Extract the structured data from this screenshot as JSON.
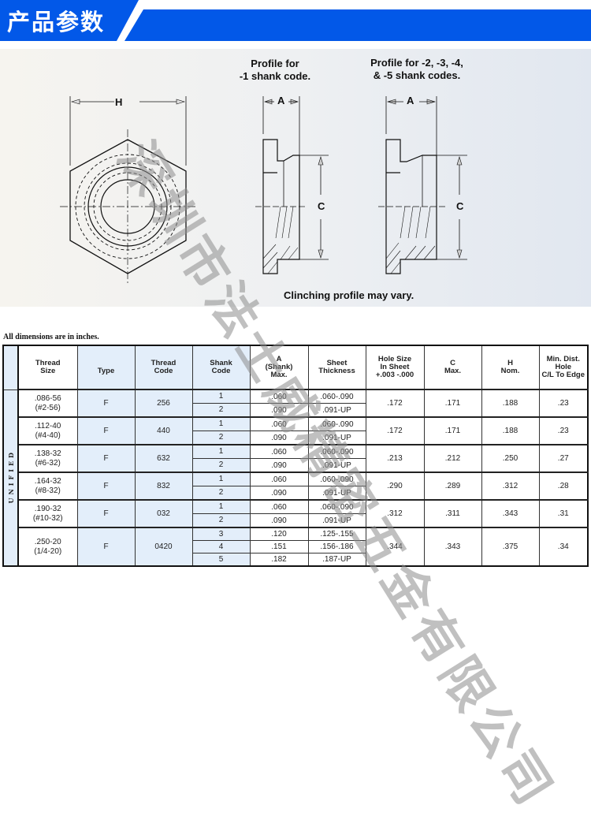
{
  "banner": {
    "title": "产品参数",
    "color": "#0258e8"
  },
  "drawing": {
    "hex_dimension_label": "H",
    "profile1_caption_line1": "Profile for",
    "profile1_caption_line2": "-1 shank code.",
    "profile2_caption_line1": "Profile for -2, -3, -4,",
    "profile2_caption_line2": "& -5 shank codes.",
    "dimension_a": "A",
    "dimension_c": "C",
    "footnote": "Clinching profile may vary."
  },
  "note": "All dimensions are in inches.",
  "table": {
    "side_label": "UNIFIED",
    "headers": {
      "thread_size": "Thread\nSize",
      "type": "Type",
      "thread_code": "Thread\nCode",
      "shank_code": "Shank\nCode",
      "a_shank_max": "A\n(Shank)\nMax.",
      "sheet_thickness": "Sheet\nThickness",
      "hole_size": "Hole Size\nIn Sheet\n+.003 -.000",
      "c_max": "C\nMax.",
      "h_nom": "H\nNom.",
      "min_dist": "Min. Dist. Hole\nC/L To Edge"
    },
    "rows": [
      {
        "thread_size": ".086-56",
        "thread_size_alt": "(#2-56)",
        "type": "F",
        "thread_code": "256",
        "shanks": [
          {
            "code": "1",
            "a": ".060",
            "sheet": ".060-.090"
          },
          {
            "code": "2",
            "a": ".090",
            "sheet": ".091-UP"
          }
        ],
        "hole": ".172",
        "c": ".171",
        "h": ".188",
        "min_dist": ".23"
      },
      {
        "thread_size": ".112-40",
        "thread_size_alt": "(#4-40)",
        "type": "F",
        "thread_code": "440",
        "shanks": [
          {
            "code": "1",
            "a": ".060",
            "sheet": ".060-.090"
          },
          {
            "code": "2",
            "a": ".090",
            "sheet": ".091-UP"
          }
        ],
        "hole": ".172",
        "c": ".171",
        "h": ".188",
        "min_dist": ".23"
      },
      {
        "thread_size": ".138-32",
        "thread_size_alt": "(#6-32)",
        "type": "F",
        "thread_code": "632",
        "shanks": [
          {
            "code": "1",
            "a": ".060",
            "sheet": ".060-.090"
          },
          {
            "code": "2",
            "a": ".090",
            "sheet": ".091-UP"
          }
        ],
        "hole": ".213",
        "c": ".212",
        "h": ".250",
        "min_dist": ".27"
      },
      {
        "thread_size": ".164-32",
        "thread_size_alt": "(#8-32)",
        "type": "F",
        "thread_code": "832",
        "shanks": [
          {
            "code": "1",
            "a": ".060",
            "sheet": ".060-.090"
          },
          {
            "code": "2",
            "a": ".090",
            "sheet": ".091-UP"
          }
        ],
        "hole": ".290",
        "c": ".289",
        "h": ".312",
        "min_dist": ".28"
      },
      {
        "thread_size": ".190-32",
        "thread_size_alt": "(#10-32)",
        "type": "F",
        "thread_code": "032",
        "shanks": [
          {
            "code": "1",
            "a": ".060",
            "sheet": ".060-.090"
          },
          {
            "code": "2",
            "a": ".090",
            "sheet": ".091-UP"
          }
        ],
        "hole": ".312",
        "c": ".311",
        "h": ".343",
        "min_dist": ".31"
      },
      {
        "thread_size": ".250-20",
        "thread_size_alt": "(1/4-20)",
        "type": "F",
        "thread_code": "0420",
        "shanks": [
          {
            "code": "3",
            "a": ".120",
            "sheet": ".125-.155"
          },
          {
            "code": "4",
            "a": ".151",
            "sheet": ".156-.186"
          },
          {
            "code": "5",
            "a": ".182",
            "sheet": ".187-UP"
          }
        ],
        "hole": ".344",
        "c": ".343",
        "h": ".375",
        "min_dist": ".34"
      }
    ]
  },
  "watermark": "深圳市法士威精密五金有限公司"
}
